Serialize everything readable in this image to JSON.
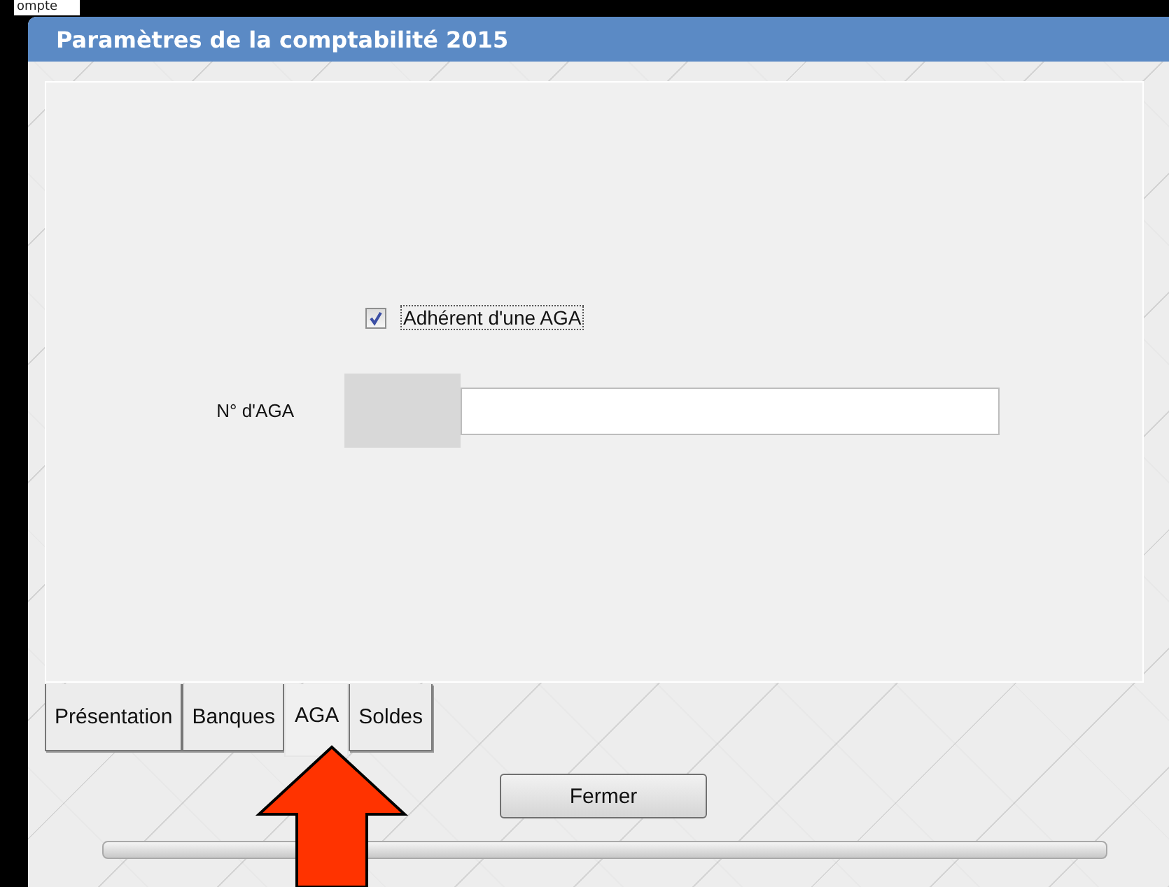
{
  "background": {
    "text": "ompte"
  },
  "window": {
    "title": "Paramètres de la comptabilité 2015"
  },
  "form": {
    "checkbox": {
      "label": "Adhérent d'une AGA",
      "checked": true
    },
    "field": {
      "label": "N° d'AGA"
    }
  },
  "tabs": [
    {
      "label": "Présentation",
      "selected": false
    },
    {
      "label": "Banques",
      "selected": false
    },
    {
      "label": "AGA",
      "selected": true
    },
    {
      "label": "Soldes",
      "selected": false
    }
  ],
  "buttons": [
    {
      "label": "Fermer"
    }
  ]
}
